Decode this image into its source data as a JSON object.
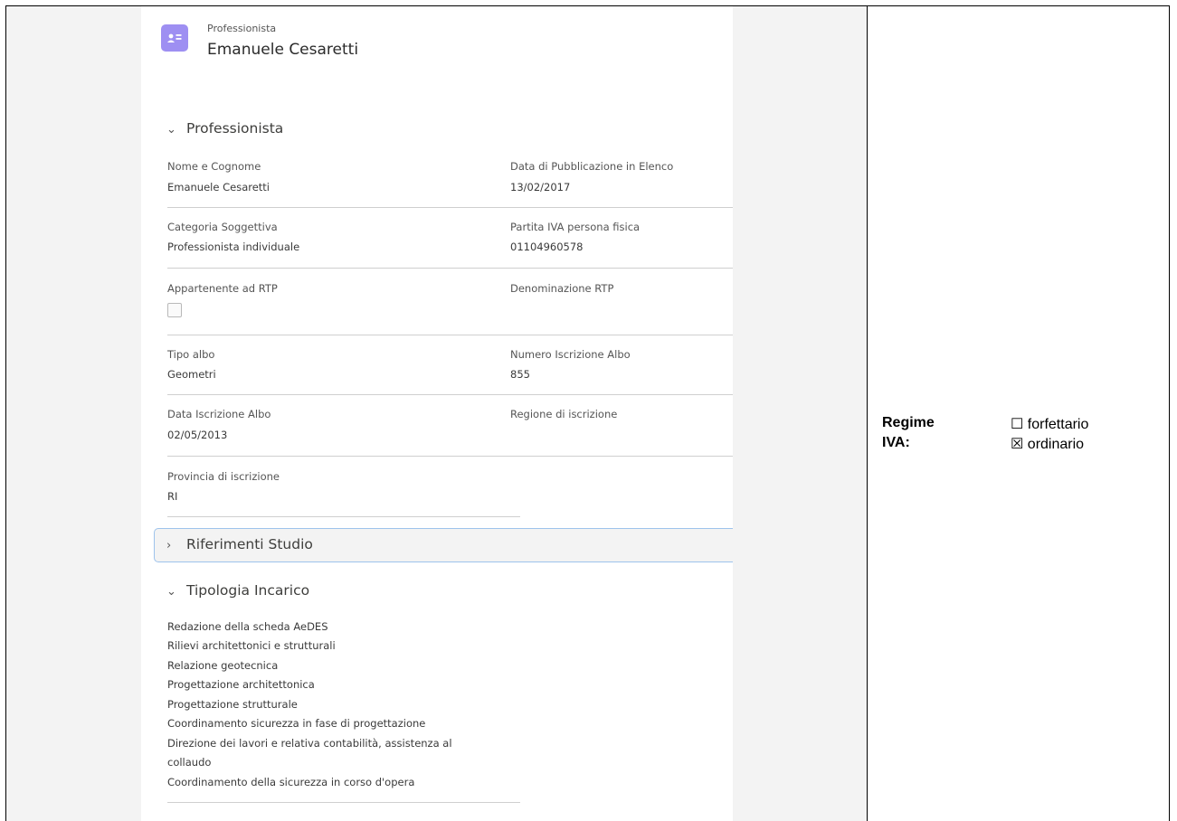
{
  "header": {
    "object_type": "Professionista",
    "record_name": "Emanuele Cesaretti"
  },
  "sections": {
    "professionista": {
      "title": "Professionista",
      "fields": {
        "nome_cognome": {
          "label": "Nome e Cognome",
          "value": "Emanuele Cesaretti"
        },
        "data_pubblicazione": {
          "label": "Data di Pubblicazione in Elenco",
          "value": "13/02/2017"
        },
        "categoria": {
          "label": "Categoria Soggettiva",
          "value": "Professionista individuale"
        },
        "partita_iva": {
          "label": "Partita IVA persona fisica",
          "value": "01104960578"
        },
        "rtp": {
          "label": "Appartenente ad RTP",
          "checked": false
        },
        "denominazione_rtp": {
          "label": "Denominazione RTP",
          "value": ""
        },
        "tipo_albo": {
          "label": "Tipo albo",
          "value": "Geometri"
        },
        "numero_albo": {
          "label": "Numero Iscrizione Albo",
          "value": "855"
        },
        "data_albo": {
          "label": "Data Iscrizione Albo",
          "value": "02/05/2013"
        },
        "regione": {
          "label": "Regione di iscrizione",
          "value": ""
        },
        "provincia": {
          "label": "Provincia di iscrizione",
          "value": "RI"
        }
      }
    },
    "riferimenti": {
      "title": "Riferimenti Studio"
    },
    "tipologia": {
      "title": "Tipologia Incarico",
      "items": [
        "Redazione della scheda AeDES",
        "Rilievi architettonici e strutturali",
        "Relazione geotecnica",
        "Progettazione architettonica",
        "Progettazione strutturale",
        "Coordinamento sicurezza in fase di progettazione",
        "Direzione dei lavori e relativa contabilità, assistenza al",
        "collaudo",
        "Coordinamento della sicurezza in corso d'opera"
      ]
    }
  },
  "regime": {
    "label_line1": "Regime",
    "label_line2": "IVA:",
    "options": [
      {
        "label": "☐ forfettario",
        "checked": false
      },
      {
        "label": "☒ ordinario",
        "checked": true
      }
    ]
  },
  "colors": {
    "icon_bg": "#9e8ff2",
    "focus_border": "#9ec3ec"
  }
}
